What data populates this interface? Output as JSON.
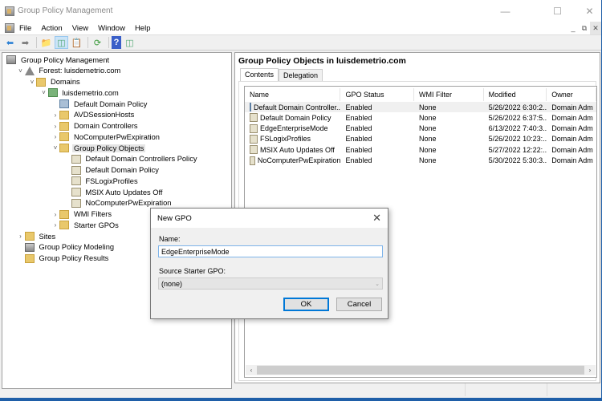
{
  "window": {
    "title": "Group Policy Management"
  },
  "menu": [
    "File",
    "Action",
    "View",
    "Window",
    "Help"
  ],
  "tree": [
    {
      "label": "Group Policy Management",
      "level": 0,
      "icon": "gpm-icon",
      "chevron": ""
    },
    {
      "label": "Forest: luisdemetrio.com",
      "level": 1,
      "icon": "forest-icon",
      "chevron": "v"
    },
    {
      "label": "Domains",
      "level": 2,
      "icon": "domains-icon",
      "chevron": "v"
    },
    {
      "label": "luisdemetrio.com",
      "level": 3,
      "icon": "domain-icon",
      "chevron": "v"
    },
    {
      "label": "Default Domain Policy",
      "level": 4,
      "icon": "gpo-link-icon",
      "chevron": ""
    },
    {
      "label": "AVDSessionHosts",
      "level": 4,
      "icon": "ou-icon",
      "chevron": ">"
    },
    {
      "label": "Domain Controllers",
      "level": 4,
      "icon": "ou-icon",
      "chevron": ">"
    },
    {
      "label": "NoComputerPwExpiration",
      "level": 4,
      "icon": "ou-icon",
      "chevron": ">"
    },
    {
      "label": "Group Policy Objects",
      "level": 4,
      "icon": "folder-icon",
      "chevron": "v",
      "selected": true
    },
    {
      "label": "Default Domain Controllers Policy",
      "level": 5,
      "icon": "gpo-icon",
      "chevron": ""
    },
    {
      "label": "Default Domain Policy",
      "level": 5,
      "icon": "gpo-icon",
      "chevron": ""
    },
    {
      "label": "FSLogixProfiles",
      "level": 5,
      "icon": "gpo-icon",
      "chevron": ""
    },
    {
      "label": "MSIX Auto Updates Off",
      "level": 5,
      "icon": "gpo-icon",
      "chevron": ""
    },
    {
      "label": "NoComputerPwExpiration",
      "level": 5,
      "icon": "gpo-icon",
      "chevron": ""
    },
    {
      "label": "WMI Filters",
      "level": 4,
      "icon": "wmi-folder-icon",
      "chevron": ">"
    },
    {
      "label": "Starter GPOs",
      "level": 4,
      "icon": "starter-folder-icon",
      "chevron": ">"
    },
    {
      "label": "Sites",
      "level": 1,
      "icon": "sites-icon",
      "chevron": ">"
    },
    {
      "label": "Group Policy Modeling",
      "level": 1,
      "icon": "modeling-icon",
      "chevron": ""
    },
    {
      "label": "Group Policy Results",
      "level": 1,
      "icon": "results-icon",
      "chevron": ""
    }
  ],
  "right": {
    "title": "Group Policy Objects in luisdemetrio.com",
    "tabs": [
      "Contents",
      "Delegation"
    ],
    "columns": [
      "Name",
      "GPO Status",
      "WMI Filter",
      "Modified",
      "Owner"
    ],
    "rows": [
      [
        "Default Domain Controller...",
        "Enabled",
        "None",
        "5/26/2022 6:30:2...",
        "Domain Adm"
      ],
      [
        "Default Domain Policy",
        "Enabled",
        "None",
        "5/26/2022 6:37:5...",
        "Domain Adm"
      ],
      [
        "EdgeEnterpriseMode",
        "Enabled",
        "None",
        "6/13/2022 7:40:3...",
        "Domain Adm"
      ],
      [
        "FSLogixProfiles",
        "Enabled",
        "None",
        "5/26/2022 10:23:...",
        "Domain Adm"
      ],
      [
        "MSIX Auto Updates Off",
        "Enabled",
        "None",
        "5/27/2022 12:22:...",
        "Domain Adm"
      ],
      [
        "NoComputerPwExpiration",
        "Enabled",
        "None",
        "5/30/2022 5:30:3...",
        "Domain Adm"
      ]
    ]
  },
  "dialog": {
    "title": "New GPO",
    "name_label": "Name:",
    "name_value": "EdgeEnterpriseMode",
    "source_label": "Source Starter GPO:",
    "source_value": "(none)",
    "ok": "OK",
    "cancel": "Cancel"
  }
}
